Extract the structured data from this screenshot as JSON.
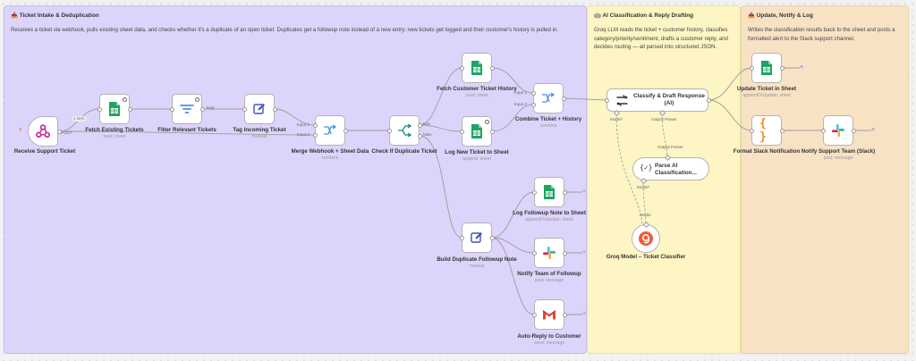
{
  "groups": {
    "intake": {
      "title": "📥 Ticket Intake & Deduplication",
      "desc": "Receives a ticket via webhook, pulls existing sheet data, and checks whether it's a duplicate of an open ticket. Duplicates get a followup note instead of a new entry; new tickets get logged and their customer's history is pulled in."
    },
    "ai": {
      "title": "🤖 AI Classification & Reply Drafting",
      "desc": "Groq LLM reads the ticket + customer history, classifies category/priority/sentiment, drafts a customer reply, and decides routing — all parsed into structured JSON."
    },
    "notify": {
      "title": "📤 Update, Notify & Log",
      "desc": "Writes the classification results back to the sheet and posts a formatted alert to the Slack support channel."
    }
  },
  "nodes": {
    "receive": {
      "label": "Receive Support Ticket",
      "sub": ""
    },
    "fetch_existing": {
      "label": "Fetch Existing Tickets",
      "sub": "read: sheet"
    },
    "filter": {
      "label": "Filter Relevant Tickets",
      "sub": ""
    },
    "tag": {
      "label": "Tag Incoming Ticket",
      "sub": "manual"
    },
    "merge": {
      "label": "Merge Webhook + Sheet Data",
      "sub": "combine"
    },
    "check": {
      "label": "Check If Duplicate Ticket",
      "sub": ""
    },
    "fetch_history": {
      "label": "Fetch Customer Ticket History",
      "sub": "read: sheet"
    },
    "log_new": {
      "label": "Log New Ticket to Sheet",
      "sub": "append: sheet"
    },
    "combine": {
      "label": "Combine Ticket + History",
      "sub": "combine"
    },
    "classify": {
      "label": "Classify & Draft Response (AI)",
      "sub": ""
    },
    "parse": {
      "label": "Parse AI Classification...",
      "sub": ""
    },
    "groq": {
      "label": "Groq Model – Ticket Classifier",
      "sub": ""
    },
    "log_followup": {
      "label": "Log Followup Note to Sheet",
      "sub": "appendOrUpdate: sheet"
    },
    "build_dup": {
      "label": "Build Duplicate Followup Note",
      "sub": "manual"
    },
    "notify_followup": {
      "label": "Notify Team of Followup",
      "sub": "post: message"
    },
    "autoreply": {
      "label": "Auto-Reply to Customer",
      "sub": "send: message"
    },
    "update_ticket": {
      "label": "Update Ticket in Sheet",
      "sub": "appendOrUpdate: sheet"
    },
    "format_slack": {
      "label": "Format Slack Notification",
      "sub": ""
    },
    "notify_support": {
      "label": "Notify Support Team (Slack)",
      "sub": "post: message"
    }
  },
  "ports": {
    "items": "1 item",
    "post": "POST",
    "kept": "kept",
    "input1": "Input 1",
    "input2": "Input 2",
    "true": "true",
    "false": "false",
    "model": "Model*",
    "output_parser": "Output Parser",
    "model2": "Model*",
    "model3": "Model"
  },
  "colors": {
    "intake_bg": "#ddd4fb",
    "ai_bg": "#fdf5c3",
    "notify_bg": "#f8e2c4",
    "sheets": "#1fa463",
    "slack_pink": "#e01e5a",
    "webhook": "#c7319f",
    "accent": "#5a5adf"
  }
}
